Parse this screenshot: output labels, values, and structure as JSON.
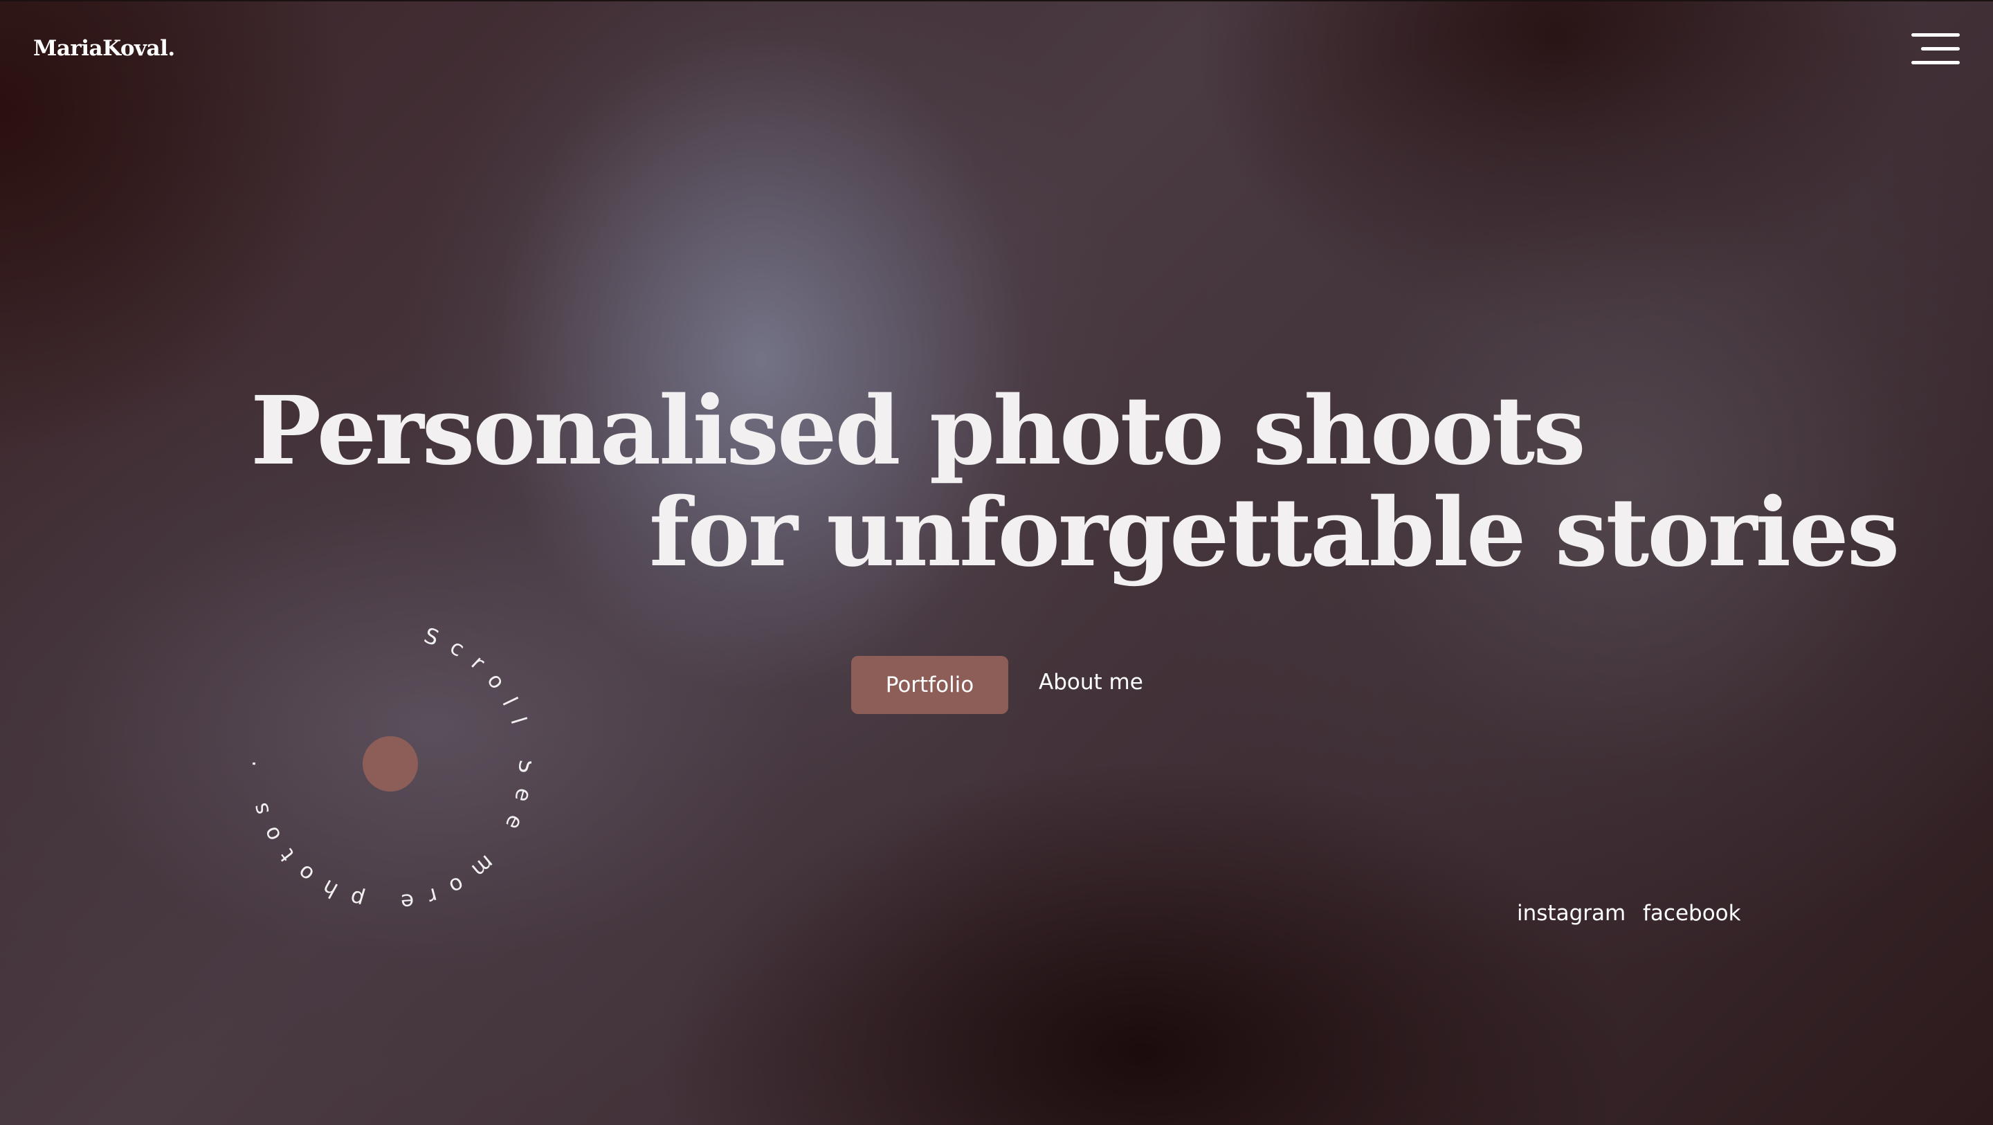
{
  "header": {
    "logo": "MariaKoval.",
    "menu_icon": "hamburger-menu-icon"
  },
  "hero": {
    "headline_line1": "Personalised photo shoots",
    "headline_line2": "for unforgettable stories",
    "primary_button": "Portfolio",
    "secondary_link": "About me"
  },
  "scroll_indicator": {
    "circular_text": "Scroll See more photos ·"
  },
  "socials": {
    "instagram": "instagram",
    "facebook": "facebook"
  },
  "colors": {
    "accent": "#8d5e58",
    "text": "#f3f0f1"
  }
}
